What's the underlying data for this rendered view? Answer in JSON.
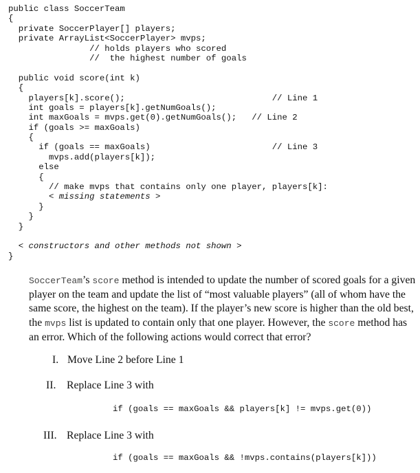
{
  "code_lines": [
    {
      "text": "public class SoccerTeam",
      "style": "normal"
    },
    {
      "text": "{",
      "style": "normal"
    },
    {
      "text": "  private SoccerPlayer[] players;",
      "style": "normal"
    },
    {
      "text": "  private ArrayList<SoccerPlayer> mvps;",
      "style": "normal"
    },
    {
      "text": "                // holds players who scored",
      "style": "normal"
    },
    {
      "text": "                //  the highest number of goals",
      "style": "normal"
    },
    {
      "text": "",
      "style": "normal"
    },
    {
      "text": "  public void score(int k)",
      "style": "normal"
    },
    {
      "text": "  {",
      "style": "normal"
    },
    {
      "text": "    players[k].score();                             // Line 1",
      "style": "normal"
    },
    {
      "text": "    int goals = players[k].getNumGoals();",
      "style": "normal"
    },
    {
      "text": "    int maxGoals = mvps.get(0).getNumGoals();   // Line 2",
      "style": "normal"
    },
    {
      "text": "    if (goals >= maxGoals)",
      "style": "normal"
    },
    {
      "text": "    {",
      "style": "normal"
    },
    {
      "text": "      if (goals == maxGoals)                        // Line 3",
      "style": "normal"
    },
    {
      "text": "        mvps.add(players[k]);",
      "style": "normal"
    },
    {
      "text": "      else",
      "style": "normal"
    },
    {
      "text": "      {",
      "style": "normal"
    },
    {
      "text": "        // make mvps that contains only one player, players[k]:",
      "style": "normal"
    },
    {
      "text": "        < missing statements >",
      "style": "italic"
    },
    {
      "text": "      }",
      "style": "normal"
    },
    {
      "text": "    }",
      "style": "normal"
    },
    {
      "text": "  }",
      "style": "normal"
    },
    {
      "text": "",
      "style": "normal"
    },
    {
      "text": "  < constructors and other methods not shown >",
      "style": "italic"
    },
    {
      "text": "}",
      "style": "normal"
    }
  ],
  "question": {
    "class_name": "SoccerTeam",
    "text_1": "’s ",
    "method_name": "score",
    "text_2": " method is intended to update the number of scored goals for a given player on the team and update the list of “most valuable players” (all of whom have the same score, the highest on the team).  If the player’s new score is higher than the old best, the ",
    "list_name": "mvps",
    "text_3": " list is updated to contain only that one player.  However, the ",
    "method_name_2": "score",
    "text_4": " method has an error.  Which of the following actions would correct that error?"
  },
  "options": [
    {
      "numeral": "I.",
      "text": "Move Line 2 before Line 1",
      "code": ""
    },
    {
      "numeral": "II.",
      "text": "Replace Line 3 with",
      "code": "if (goals == maxGoals && players[k] != mvps.get(0))"
    },
    {
      "numeral": "III.",
      "text": "Replace Line 3 with",
      "code": "if (goals == maxGoals && !mvps.contains(players[k]))"
    }
  ]
}
